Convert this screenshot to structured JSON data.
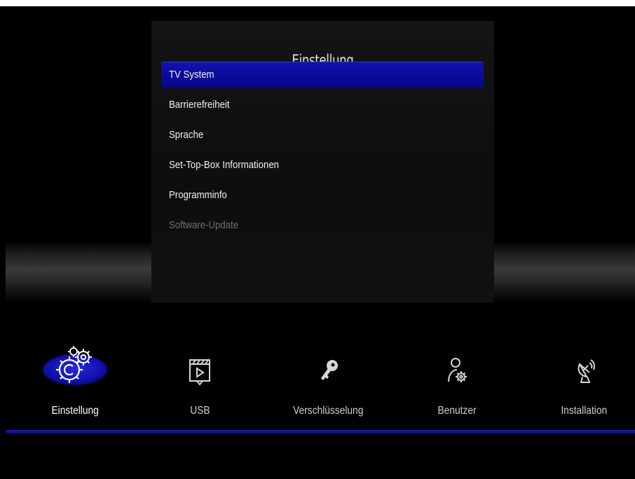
{
  "panel": {
    "title": "Einstellung"
  },
  "menu": {
    "items": [
      {
        "label": "TV System",
        "state": "selected"
      },
      {
        "label": "Barrierefreiheit",
        "state": "normal"
      },
      {
        "label": "Sprache",
        "state": "normal"
      },
      {
        "label": "Set-Top-Box Informationen",
        "state": "normal"
      },
      {
        "label": "Programminfo",
        "state": "normal"
      },
      {
        "label": "Software-Update",
        "state": "disabled"
      }
    ]
  },
  "nav": {
    "items": [
      {
        "label": "Einstellung",
        "icon": "gears-icon",
        "active": true
      },
      {
        "label": "USB",
        "icon": "media-clapper-icon",
        "active": false
      },
      {
        "label": "Verschlüsselung",
        "icon": "key-icon",
        "active": false
      },
      {
        "label": "Benutzer",
        "icon": "user-gear-icon",
        "active": false
      },
      {
        "label": "Installation",
        "icon": "satellite-dish-icon",
        "active": false
      }
    ]
  },
  "colors": {
    "selection": "#0a0a9a",
    "accent_line": "#1414a0",
    "text": "#f2f2f2",
    "disabled_text": "#6f6f6f"
  }
}
